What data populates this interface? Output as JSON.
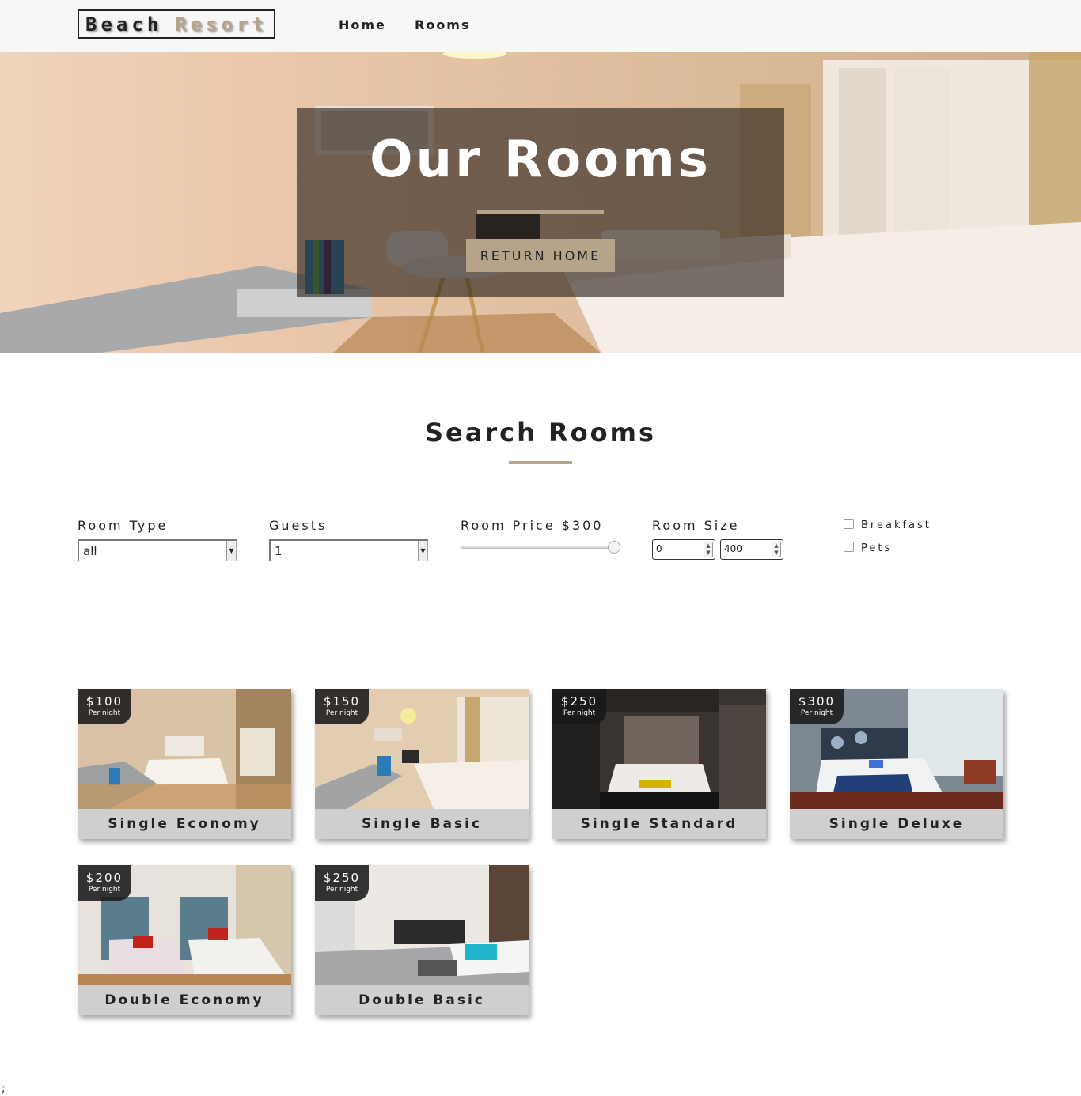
{
  "nav": {
    "logo_word1": "Beach",
    "logo_word2": "Resort",
    "links": [
      "Home",
      "Rooms"
    ]
  },
  "hero": {
    "title": "Our Rooms",
    "button": "RETURN HOME"
  },
  "search": {
    "title": "Search Rooms",
    "room_type": {
      "label": "Room Type",
      "value": "all"
    },
    "guests": {
      "label": "Guests",
      "value": "1"
    },
    "price": {
      "label": "Room Price $300",
      "value": 300,
      "max": 300
    },
    "size": {
      "label": "Room Size",
      "min": "0",
      "max": "400"
    },
    "breakfast": {
      "label": "Breakfast",
      "checked": false
    },
    "pets": {
      "label": "Pets",
      "checked": false
    }
  },
  "rooms": [
    {
      "name": "Single Economy",
      "price": "$100",
      "per": "Per night"
    },
    {
      "name": "Single Basic",
      "price": "$150",
      "per": "Per night"
    },
    {
      "name": "Single Standard",
      "price": "$250",
      "per": "Per night"
    },
    {
      "name": "Single Deluxe",
      "price": "$300",
      "per": "Per night"
    },
    {
      "name": "Double Economy",
      "price": "$200",
      "per": "Per night"
    },
    {
      "name": "Double Basic",
      "price": "$250",
      "per": "Per night"
    }
  ],
  "footer_text": ";",
  "colors": {
    "accent": "#b5a38a",
    "dark": "#222222",
    "card_bg": "#cfcfcf"
  }
}
